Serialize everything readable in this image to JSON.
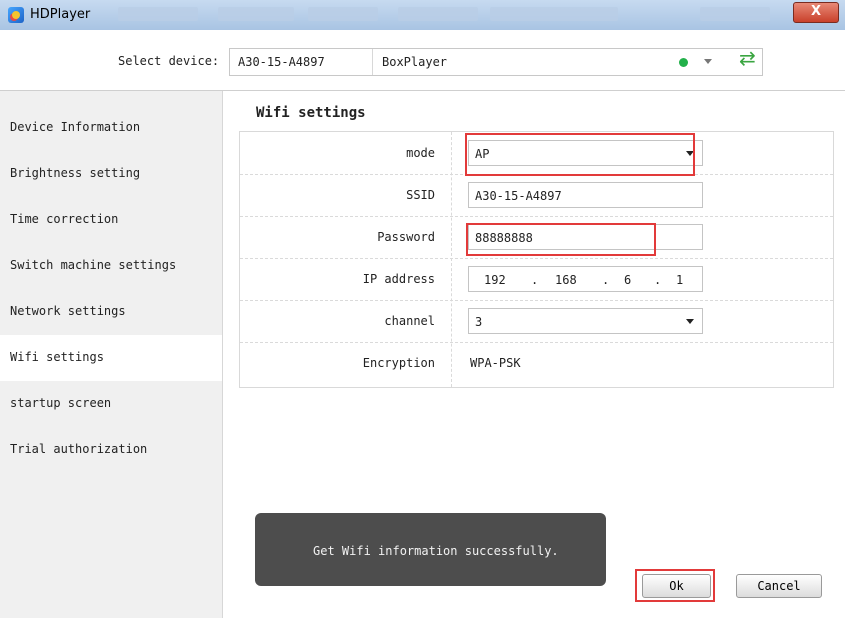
{
  "window": {
    "title": "HDPlayer",
    "close_glyph": "X"
  },
  "device_bar": {
    "label": "Select device:",
    "device_id": "A30-15-A4897",
    "device_name": "BoxPlayer",
    "status_color": "#22b04a",
    "refresh_icon": "refresh-icon"
  },
  "sidebar": {
    "items": [
      {
        "label": "Device Information"
      },
      {
        "label": "Brightness setting"
      },
      {
        "label": "Time correction"
      },
      {
        "label": "Switch machine settings"
      },
      {
        "label": "Network settings"
      },
      {
        "label": "Wifi settings",
        "active": true
      },
      {
        "label": "startup screen"
      },
      {
        "label": "Trial authorization"
      }
    ]
  },
  "main": {
    "title": "Wifi settings",
    "fields": {
      "mode": {
        "label": "mode",
        "value": "AP"
      },
      "ssid": {
        "label": "SSID",
        "value": "A30-15-A4897"
      },
      "password": {
        "label": "Password",
        "value": "88888888"
      },
      "ip": {
        "label": "IP address",
        "octets": [
          "192",
          "168",
          "6",
          "1"
        ],
        "separator": "."
      },
      "channel": {
        "label": "channel",
        "value": "3"
      },
      "encryption": {
        "label": "Encryption",
        "value": "WPA-PSK"
      }
    },
    "toast": "Get Wifi information successfully.",
    "ok_label": "Ok",
    "cancel_label": "Cancel"
  },
  "colors": {
    "highlight": "#e23a3a",
    "toast_bg": "#4d4d4d"
  }
}
